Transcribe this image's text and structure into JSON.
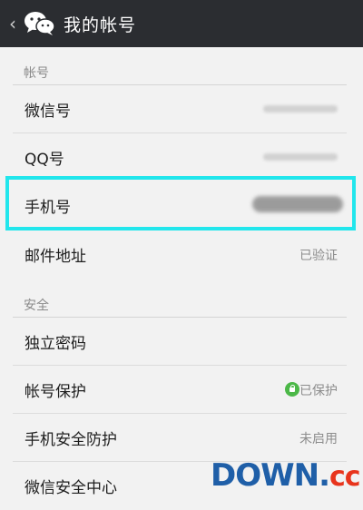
{
  "header": {
    "back_glyph": "‹",
    "title": "我的帐号",
    "colors": {
      "background": "#2b2d31",
      "text": "#ffffff"
    }
  },
  "sections": {
    "account": {
      "label": "帐号"
    },
    "security": {
      "label": "安全"
    }
  },
  "rows": {
    "wechat_id": {
      "label": "微信号",
      "value_redacted": true
    },
    "qq_id": {
      "label": "QQ号",
      "value_redacted": true
    },
    "phone": {
      "label": "手机号",
      "value_redacted": true
    },
    "email": {
      "label": "邮件地址",
      "value": "已验证"
    },
    "password": {
      "label": "独立密码"
    },
    "account_protection": {
      "label": "帐号保护",
      "value": "已保护"
    },
    "phone_security": {
      "label": "手机安全防护",
      "value": "未启用"
    },
    "security_center": {
      "label": "微信安全中心"
    }
  },
  "highlight_color": "#22e6ec",
  "watermark": {
    "main": "DOWN",
    "dot": ".",
    "suffix": "cc"
  }
}
